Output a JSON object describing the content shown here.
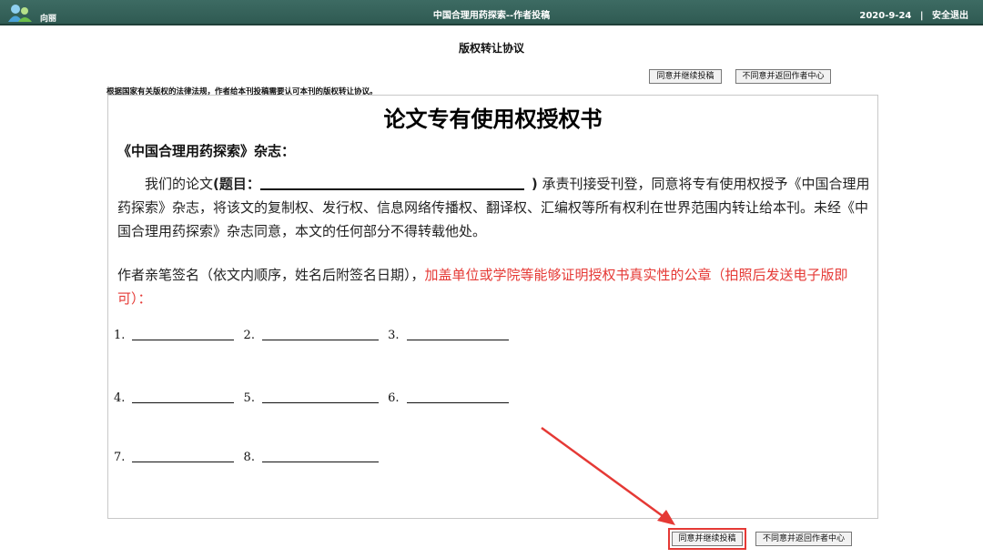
{
  "header": {
    "user_name": "向丽",
    "system_title": "中国合理用药探索--作者投稿",
    "date": "2020-9-24",
    "separator": "|",
    "logout_label": "安全退出"
  },
  "page": {
    "title": "版权转让协议",
    "notice": "根据国家有关版权的法律法规，作者给本刊投稿需要认可本刊的版权转让协议。"
  },
  "buttons": {
    "agree_label": "同意并继续投稿",
    "disagree_label": "不同意并返回作者中心"
  },
  "document": {
    "title": "论文专有使用权授权书",
    "journal_line": "《中国合理用药探索》杂志：",
    "para_prefix": "我们的论文",
    "para_label": "(题目：",
    "para_close": ")",
    "para_text": "承责刊接受刊登，同意将专有使用权授予《中国合理用药探索》杂志，将该文的复制权、发行权、信息网络传播权、翻译权、汇编权等所有权利在世界范围内转让给本刊。未经《中国合理用药探索》杂志同意，本文的任何部分不得转载他处。",
    "sign_text": "作者亲笔签名（依文内顺序，姓名后附签名日期），",
    "sign_red_text": "加盖单位或学院等能够证明授权书真实性的公章（拍照后发送电子版即可）：",
    "signatures": [
      "1.",
      "2.",
      "3.",
      "4.",
      "5.",
      "6.",
      "7.",
      "8."
    ]
  },
  "colors": {
    "header_bg": "#2f5a52",
    "annotation_red": "#e53935"
  },
  "icons": {
    "user": "users-icon"
  }
}
